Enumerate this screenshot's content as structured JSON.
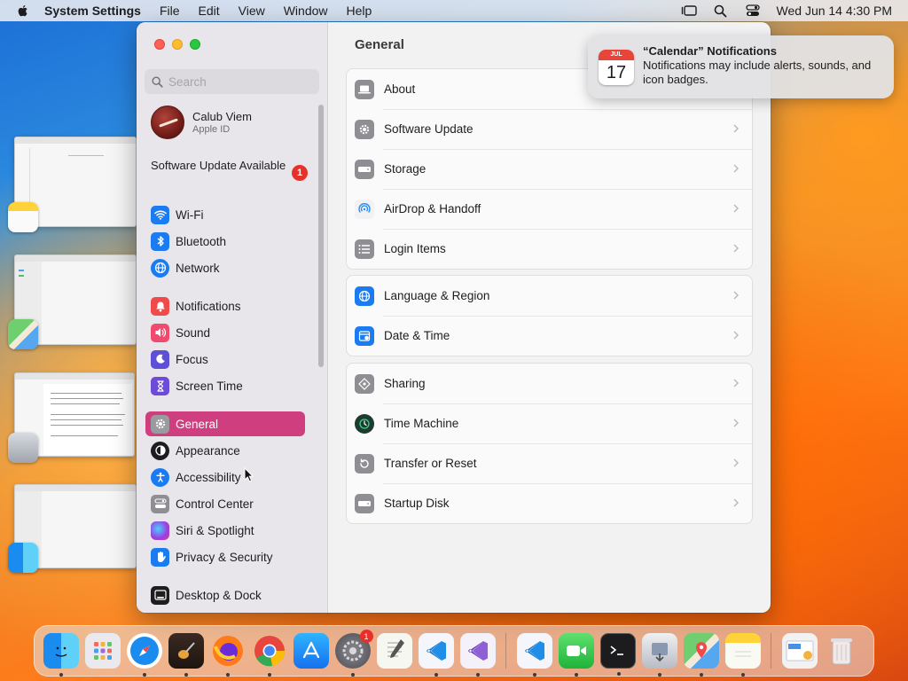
{
  "menubar": {
    "app_name": "System Settings",
    "items": [
      "File",
      "Edit",
      "View",
      "Window",
      "Help"
    ],
    "clock": "Wed Jun 14  4:30 PM"
  },
  "sidebar": {
    "search_placeholder": "Search",
    "profile": {
      "name": "Calub Viem",
      "subtitle": "Apple ID"
    },
    "update_text": "Software Update Available",
    "update_badge": "1",
    "items": [
      {
        "label": "Wi-Fi",
        "icon": "wifi-icon",
        "color": "#1a7cf0"
      },
      {
        "label": "Bluetooth",
        "icon": "bluetooth-icon",
        "color": "#1a7cf0"
      },
      {
        "label": "Network",
        "icon": "network-icon",
        "color": "#1a7cf0"
      },
      {
        "label": "Notifications",
        "icon": "bell-icon",
        "color": "#f04b4b"
      },
      {
        "label": "Sound",
        "icon": "speaker-icon",
        "color": "#f04b6e"
      },
      {
        "label": "Focus",
        "icon": "moon-icon",
        "color": "#5e50d6"
      },
      {
        "label": "Screen Time",
        "icon": "hourglass-icon",
        "color": "#6e4ad9"
      },
      {
        "label": "General",
        "icon": "gear-icon",
        "color": "#8e8e93",
        "selected": true
      },
      {
        "label": "Appearance",
        "icon": "appearance-icon",
        "color": "#1d1d1f"
      },
      {
        "label": "Accessibility",
        "icon": "accessibility-icon",
        "color": "#1a7cf0"
      },
      {
        "label": "Control Center",
        "icon": "control-center-icon",
        "color": "#8e8e93"
      },
      {
        "label": "Siri & Spotlight",
        "icon": "siri-icon",
        "color": "#9b3de0"
      },
      {
        "label": "Privacy & Security",
        "icon": "hand-icon",
        "color": "#1a7cf0"
      },
      {
        "label": "Desktop & Dock",
        "icon": "dock-icon",
        "color": "#1d1d1f"
      }
    ]
  },
  "content": {
    "title": "General",
    "groups": [
      [
        {
          "label": "About",
          "icon": "laptop-icon"
        },
        {
          "label": "Software Update",
          "icon": "gear-badge-icon"
        },
        {
          "label": "Storage",
          "icon": "storage-icon"
        },
        {
          "label": "AirDrop & Handoff",
          "icon": "airdrop-icon"
        },
        {
          "label": "Login Items",
          "icon": "list-icon"
        }
      ],
      [
        {
          "label": "Language & Region",
          "icon": "globe-icon"
        },
        {
          "label": "Date & Time",
          "icon": "calendar-clock-icon"
        }
      ],
      [
        {
          "label": "Sharing",
          "icon": "sharing-icon"
        },
        {
          "label": "Time Machine",
          "icon": "time-machine-icon"
        },
        {
          "label": "Transfer or Reset",
          "icon": "reset-icon"
        },
        {
          "label": "Startup Disk",
          "icon": "disk-icon"
        }
      ]
    ]
  },
  "notification": {
    "title": "“Calendar” Notifications",
    "body": "Notifications may include alerts, sounds, and icon badges.",
    "cal_month": "JUL",
    "cal_day": "17"
  },
  "dock": {
    "apps": [
      "Finder",
      "Launchpad",
      "Safari",
      "GarageBand",
      "Firefox",
      "Chrome",
      "App Store",
      "System Settings",
      "TextEdit",
      "Visual Studio Code",
      "Visual Studio",
      "Visual Studio Code Insiders",
      "FaceTime",
      "Terminal",
      "Preview",
      "Maps",
      "Notes",
      "Downloads",
      "Trash"
    ],
    "system_settings_badge": "1"
  }
}
